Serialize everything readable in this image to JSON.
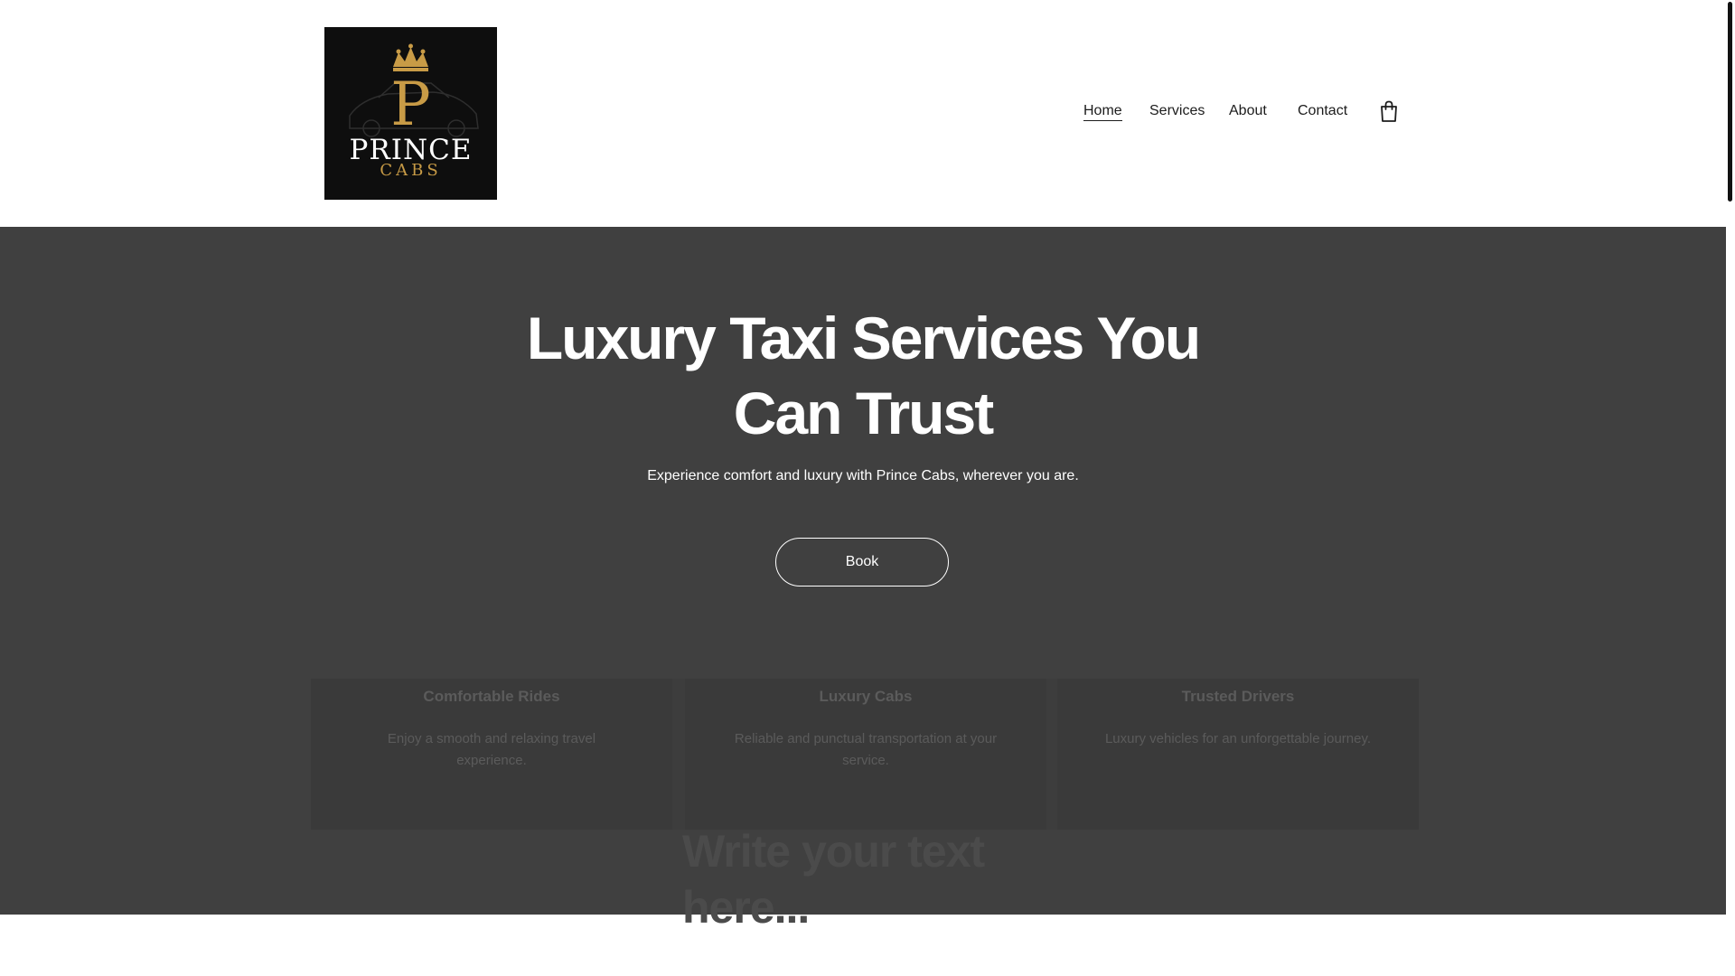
{
  "brand": {
    "logo_letter": "P",
    "logo_word1": "PRINCE",
    "logo_word2": "CABS",
    "logo_bg": "#0e0e0e",
    "logo_gold": "#c89b46"
  },
  "nav": {
    "items": [
      {
        "label": "Home",
        "active": true
      },
      {
        "label": "Services",
        "active": false
      },
      {
        "label": "About",
        "active": false
      },
      {
        "label": "Contact",
        "active": false
      }
    ],
    "cart_icon": "shopping-bag-icon"
  },
  "hero": {
    "title": "Luxury Taxi Services You Can Trust",
    "subtitle": "Experience comfort and luxury with Prince Cabs, wherever you are.",
    "button_label": "Book",
    "background": "#404040"
  },
  "features": [
    {
      "title": "Comfortable Rides",
      "description": "Enjoy a smooth and relaxing travel experience."
    },
    {
      "title": "Luxury Cabs",
      "description": "Reliable and punctual transportation at your service."
    },
    {
      "title": "Trusted Drivers",
      "description": "Luxury vehicles for an unforgettable journey."
    }
  ],
  "placeholder_text": "Write your text here..."
}
